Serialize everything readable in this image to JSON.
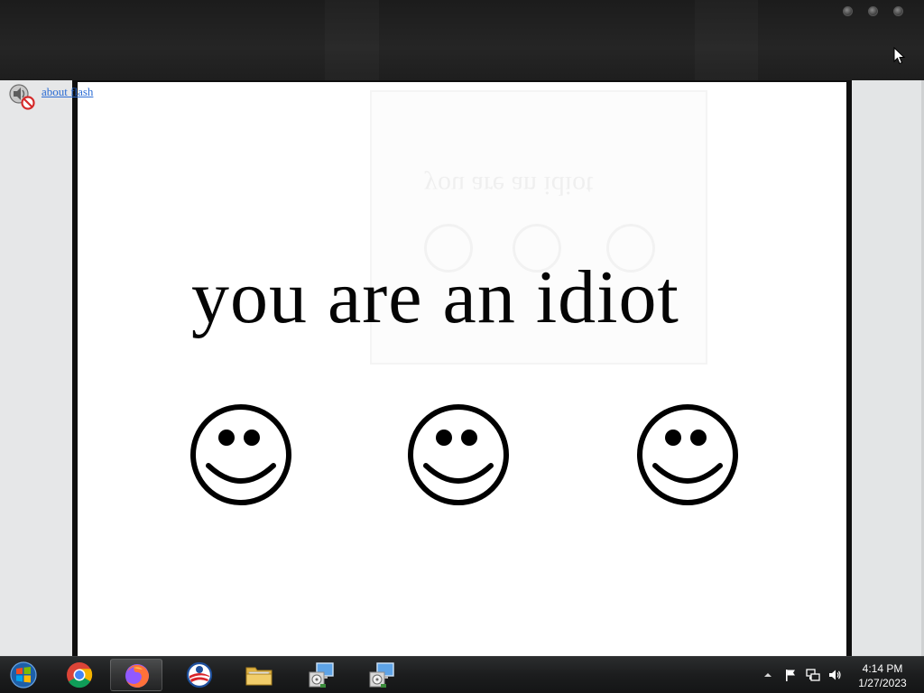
{
  "page": {
    "flash_link_label": "about flash",
    "headline": "you are an idiot",
    "ghost_headline": "you are an idiot"
  },
  "window_controls": [
    "minimize-icon",
    "maximize-icon",
    "close-icon"
  ],
  "smileys": [
    "smiley-face-icon",
    "smiley-face-icon",
    "smiley-face-icon"
  ],
  "taskbar": {
    "apps": [
      {
        "name": "start-button",
        "icon": "windows-logo-icon"
      },
      {
        "name": "chrome",
        "icon": "chrome-icon"
      },
      {
        "name": "firefox",
        "icon": "firefox-icon",
        "active": true
      },
      {
        "name": "opera",
        "icon": "opera-icon"
      },
      {
        "name": "file-explorer",
        "icon": "folder-icon"
      },
      {
        "name": "installer-1",
        "icon": "installer-icon"
      },
      {
        "name": "installer-2",
        "icon": "installer-icon"
      }
    ],
    "tray_icons": [
      "show-hidden-icons-arrow",
      "action-center-flag-icon",
      "network-icon",
      "volume-icon"
    ],
    "time": "4:14 PM",
    "date": "1/27/2023"
  },
  "colors": {
    "link": "#2b6cd4",
    "text": "#050505",
    "frame": "#0f0f0f"
  }
}
